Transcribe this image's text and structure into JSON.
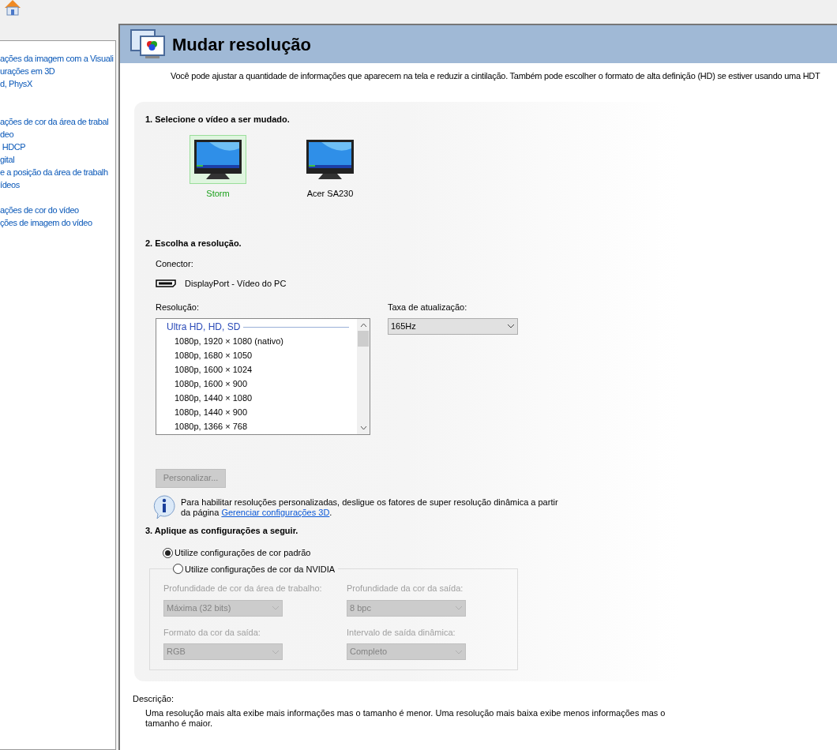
{
  "sidebar": {
    "groups": [
      {
        "items": [
          "ações da imagem com a Visuali",
          "urações em 3D",
          "d, PhysX"
        ]
      },
      {
        "items": [
          "ações de cor da área de trabal",
          "deo",
          " HDCP",
          "gital",
          "e a posição da área de trabalh",
          "ídeos"
        ]
      },
      {
        "items": [
          "ações de cor do vídeo",
          "ções de imagem do vídeo"
        ]
      }
    ]
  },
  "page": {
    "title": "Mudar resolução",
    "intro": "Você pode ajustar a quantidade de informações que aparecem na tela e reduzir  a cintilação. Também pode escolher o formato de alta definição (HD) se estiver usando uma HDT"
  },
  "section1": {
    "heading": "1. Selecione o vídeo a ser mudado.",
    "displays": [
      {
        "name": "Storm",
        "selected": true
      },
      {
        "name": "Acer SA230",
        "selected": false
      }
    ]
  },
  "section2": {
    "heading": "2. Escolha a resolução.",
    "connector_label": "Conector:",
    "connector": "DisplayPort - Vídeo do PC",
    "resolution_label": "Resolução:",
    "resolution_group": "Ultra HD, HD, SD",
    "resolutions": [
      {
        "label": "1080p, 1920 × 1080 (nativo)",
        "selected": false
      },
      {
        "label": "1080p, 1680 × 1050",
        "selected": false
      },
      {
        "label": "1080p, 1600 × 1024",
        "selected": false
      },
      {
        "label": "1080p, 1600 × 900",
        "selected": false
      },
      {
        "label": "1080p, 1440 × 1080",
        "selected": false
      },
      {
        "label": "1080p, 1440 × 900",
        "selected": false
      },
      {
        "label": "1080p, 1366 × 768",
        "selected": false
      }
    ],
    "refresh_label": "Taxa de atualização:",
    "refresh_value": "165Hz",
    "customize_button": {
      "label": "Personalizar...",
      "disabled": true
    },
    "info_text": "Para habilitar resoluções personalizadas, desligue os fatores de super resolução dinâmica a partir da página ",
    "info_link": "Gerenciar configurações 3D",
    "info_end": "."
  },
  "section3": {
    "heading": "3. Aplique as configurações a seguir.",
    "options": [
      {
        "label": "Utilize configurações de cor padrão",
        "selected": true
      },
      {
        "label": "Utilize configurações de cor da NVIDIA",
        "selected": false
      }
    ],
    "fields": [
      {
        "label": "Profundidade de cor da área de trabalho:",
        "value": "Máxima (32 bits)",
        "disabled": true
      },
      {
        "label": "Profundidade da cor da saída:",
        "value": "8 bpc",
        "disabled": true
      },
      {
        "label": "Formato da cor da saída:",
        "value": "RGB",
        "disabled": true
      },
      {
        "label": "Intervalo de saída dinâmica:",
        "value": "Completo",
        "disabled": true
      }
    ]
  },
  "description": {
    "label": "Descrição:",
    "text": "Uma resolução mais alta exibe mais informações mas o tamanho é menor. Uma resolução mais baixa exibe menos informações mas o tamanho é maior."
  }
}
